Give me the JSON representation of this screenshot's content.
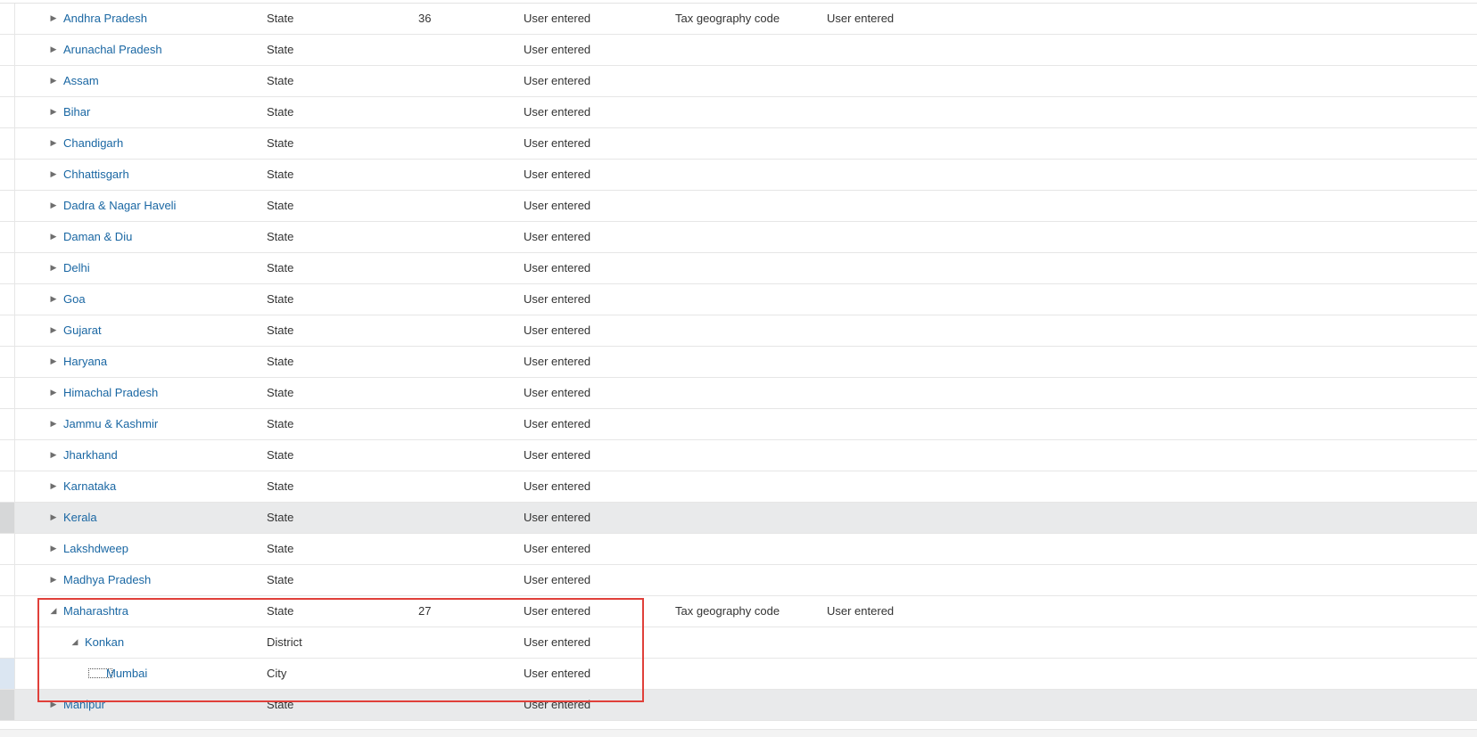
{
  "rows": [
    {
      "name": "Andhra Pradesh",
      "type": "State",
      "code": "36",
      "source": "User entered",
      "code_type": "Tax geography code",
      "code_source": "User entered",
      "level": 0,
      "state": "collapsed"
    },
    {
      "name": "Arunachal Pradesh",
      "type": "State",
      "code": "",
      "source": "User entered",
      "code_type": "",
      "code_source": "",
      "level": 0,
      "state": "collapsed"
    },
    {
      "name": "Assam",
      "type": "State",
      "code": "",
      "source": "User entered",
      "code_type": "",
      "code_source": "",
      "level": 0,
      "state": "collapsed"
    },
    {
      "name": "Bihar",
      "type": "State",
      "code": "",
      "source": "User entered",
      "code_type": "",
      "code_source": "",
      "level": 0,
      "state": "collapsed"
    },
    {
      "name": "Chandigarh",
      "type": "State",
      "code": "",
      "source": "User entered",
      "code_type": "",
      "code_source": "",
      "level": 0,
      "state": "collapsed"
    },
    {
      "name": "Chhattisgarh",
      "type": "State",
      "code": "",
      "source": "User entered",
      "code_type": "",
      "code_source": "",
      "level": 0,
      "state": "collapsed"
    },
    {
      "name": "Dadra & Nagar Haveli",
      "type": "State",
      "code": "",
      "source": "User entered",
      "code_type": "",
      "code_source": "",
      "level": 0,
      "state": "collapsed"
    },
    {
      "name": "Daman & Diu",
      "type": "State",
      "code": "",
      "source": "User entered",
      "code_type": "",
      "code_source": "",
      "level": 0,
      "state": "collapsed"
    },
    {
      "name": "Delhi",
      "type": "State",
      "code": "",
      "source": "User entered",
      "code_type": "",
      "code_source": "",
      "level": 0,
      "state": "collapsed"
    },
    {
      "name": "Goa",
      "type": "State",
      "code": "",
      "source": "User entered",
      "code_type": "",
      "code_source": "",
      "level": 0,
      "state": "collapsed"
    },
    {
      "name": "Gujarat",
      "type": "State",
      "code": "",
      "source": "User entered",
      "code_type": "",
      "code_source": "",
      "level": 0,
      "state": "collapsed"
    },
    {
      "name": "Haryana",
      "type": "State",
      "code": "",
      "source": "User entered",
      "code_type": "",
      "code_source": "",
      "level": 0,
      "state": "collapsed"
    },
    {
      "name": "Himachal Pradesh",
      "type": "State",
      "code": "",
      "source": "User entered",
      "code_type": "",
      "code_source": "",
      "level": 0,
      "state": "collapsed"
    },
    {
      "name": "Jammu & Kashmir",
      "type": "State",
      "code": "",
      "source": "User entered",
      "code_type": "",
      "code_source": "",
      "level": 0,
      "state": "collapsed"
    },
    {
      "name": "Jharkhand",
      "type": "State",
      "code": "",
      "source": "User entered",
      "code_type": "",
      "code_source": "",
      "level": 0,
      "state": "collapsed"
    },
    {
      "name": "Karnataka",
      "type": "State",
      "code": "",
      "source": "User entered",
      "code_type": "",
      "code_source": "",
      "level": 0,
      "state": "collapsed"
    },
    {
      "name": "Kerala",
      "type": "State",
      "code": "",
      "source": "User entered",
      "code_type": "",
      "code_source": "",
      "level": 0,
      "state": "collapsed",
      "shaded": true
    },
    {
      "name": "Lakshdweep",
      "type": "State",
      "code": "",
      "source": "User entered",
      "code_type": "",
      "code_source": "",
      "level": 0,
      "state": "collapsed"
    },
    {
      "name": "Madhya Pradesh",
      "type": "State",
      "code": "",
      "source": "User entered",
      "code_type": "",
      "code_source": "",
      "level": 0,
      "state": "collapsed"
    },
    {
      "name": "Maharashtra",
      "type": "State",
      "code": "27",
      "source": "User entered",
      "code_type": "Tax geography code",
      "code_source": "User entered",
      "level": 0,
      "state": "expanded"
    },
    {
      "name": "Konkan",
      "type": "District",
      "code": "",
      "source": "User entered",
      "code_type": "",
      "code_source": "",
      "level": 1,
      "state": "expanded"
    },
    {
      "name": "Mumbai",
      "type": "City",
      "code": "",
      "source": "User entered",
      "code_type": "",
      "code_source": "",
      "level": 2,
      "state": "leaf",
      "current": true
    },
    {
      "name": "Manipur",
      "type": "State",
      "code": "",
      "source": "User entered",
      "code_type": "",
      "code_source": "",
      "level": 0,
      "state": "collapsed",
      "shaded": true
    }
  ],
  "icons": {
    "collapsed": "triangle-right-icon",
    "expanded": "triangle-down-icon"
  },
  "colors": {
    "link": "#1a67a3",
    "highlight_border": "#e0403a",
    "selected_row": "#e9eaeb"
  }
}
